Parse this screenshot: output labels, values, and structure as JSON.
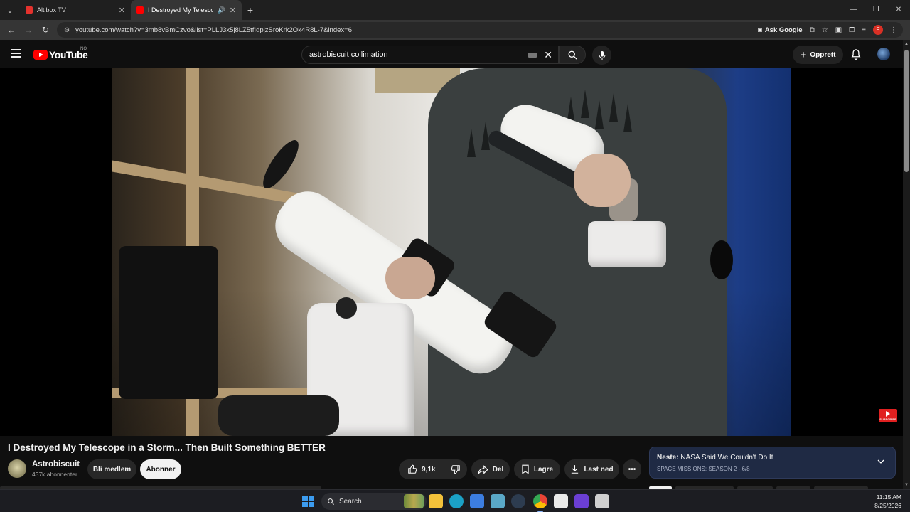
{
  "browser": {
    "tabs": [
      {
        "title": "Altibox TV",
        "favicon_color": "#e5322d",
        "active": false
      },
      {
        "title": "I Destroyed My Telescope in",
        "favicon_color": "#ff0000",
        "active": true
      }
    ],
    "new_tab_symbol": "+",
    "window_controls": {
      "minimize": "—",
      "maximize": "❐",
      "close": "✕"
    },
    "url": "youtube.com/watch?v=3mb8vBmCzvo&list=PLLJ3x5j8LZ5tfIdpjzSroKrk2Ok4R8L-7&index=6",
    "ask_google_label": "Ask Google",
    "profile_initial": "F"
  },
  "youtube": {
    "logo_text": "YouTube",
    "region": "NO",
    "search_query": "astrobiscuit collimation",
    "create_label": "Opprett"
  },
  "video": {
    "title": "I Destroyed My Telescope in a Storm... Then Built Something BETTER",
    "watermark_text": "SUBSCRIBE"
  },
  "channel": {
    "name": "Astrobiscuit",
    "subscribers": "437k abonnenter",
    "member_label": "Bli medlem",
    "subscribe_label": "Abonner"
  },
  "actions": {
    "likes": "9,1k",
    "share_label": "Del",
    "save_label": "Lagre",
    "download_label": "Last ned",
    "more_label": "•••"
  },
  "up_next": {
    "prefix": "Neste:",
    "title": "NASA Said We Couldn't Do It",
    "playlist": "SPACE MISSIONS: SEASON 2 - 6/8"
  },
  "taskbar": {
    "search_label": "Search",
    "time": "11:15 AM",
    "date": "8/25/2026"
  },
  "colors": {
    "accent_red": "#ff0000",
    "background": "#0f0f0f",
    "up_next_bg": "#1f2a44"
  }
}
